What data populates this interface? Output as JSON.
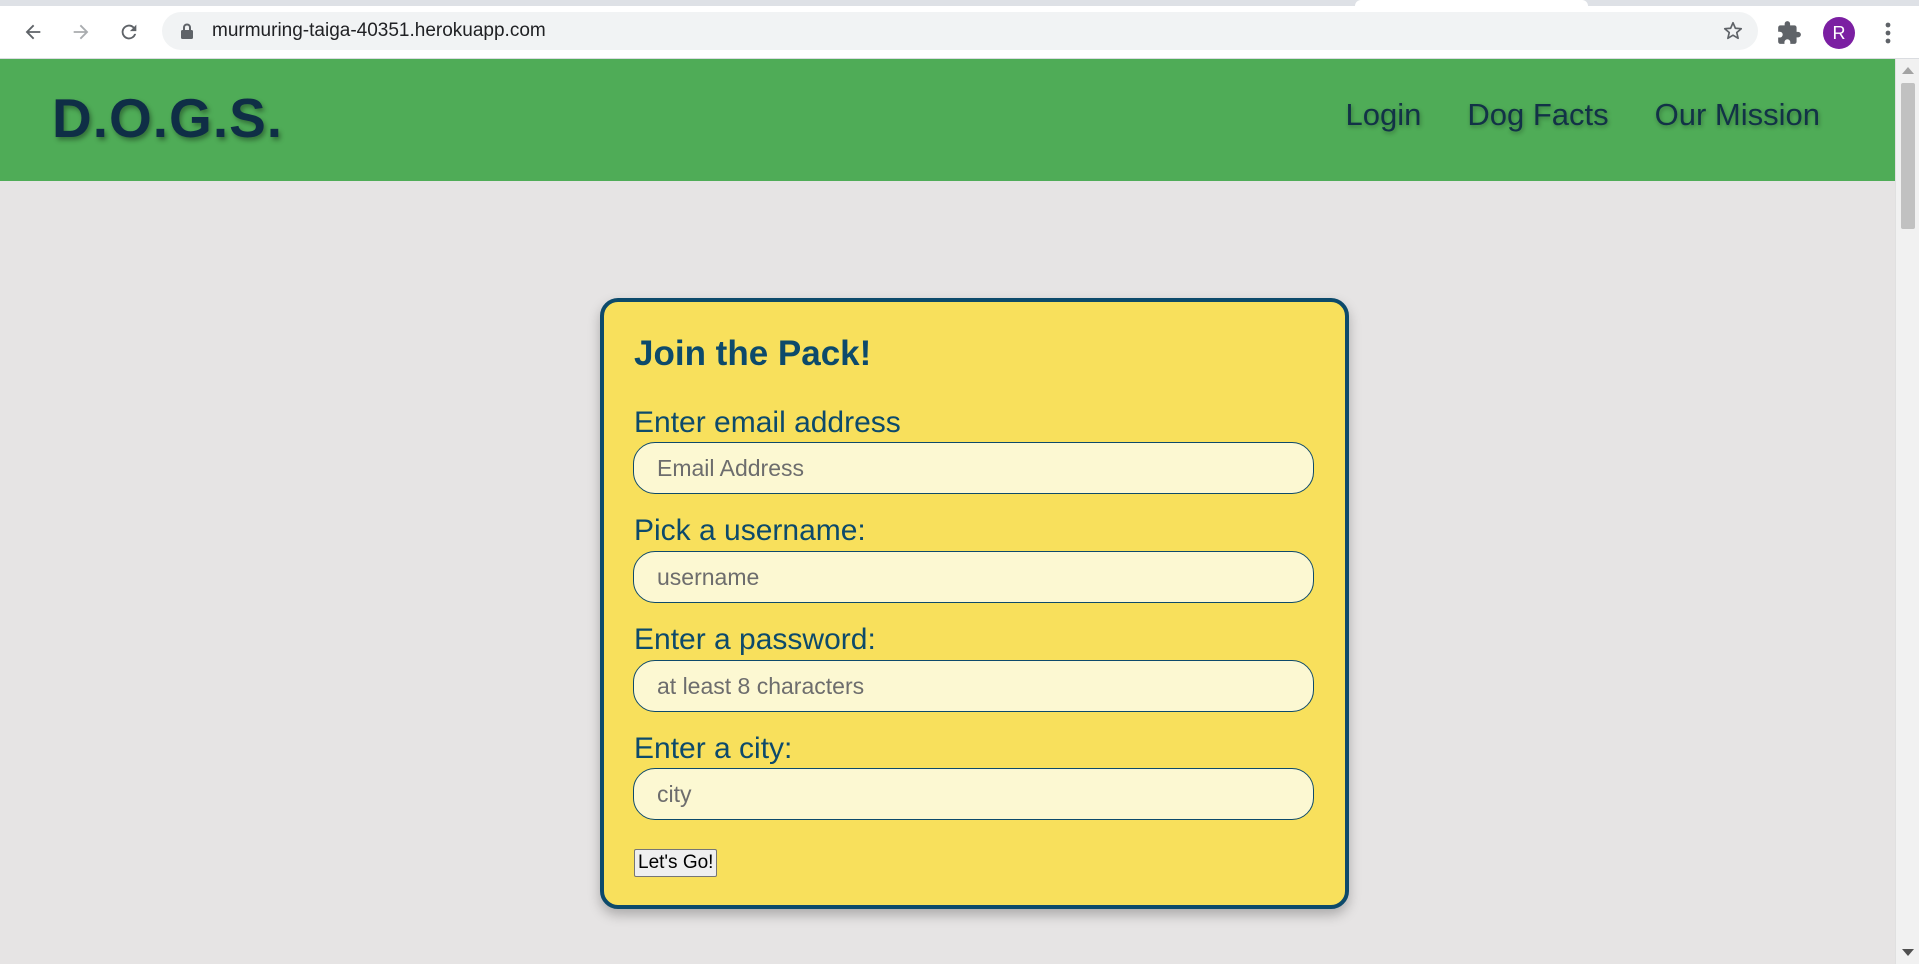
{
  "browser": {
    "url": "murmuring-taiga-40351.herokuapp.com",
    "profile_initial": "R",
    "icons": {
      "back": "arrow-left-icon",
      "forward": "arrow-right-icon",
      "reload": "reload-icon",
      "lock": "lock-icon",
      "bookmark": "star-icon",
      "extensions": "puzzle-icon",
      "menu": "kebab-menu-icon"
    }
  },
  "site": {
    "brand": "D.O.G.S.",
    "nav": [
      {
        "label": "Login"
      },
      {
        "label": "Dog Facts"
      },
      {
        "label": "Our Mission"
      }
    ]
  },
  "signup": {
    "title": "Join the Pack!",
    "fields": [
      {
        "label": "Enter email address",
        "placeholder": "Email Address",
        "value": ""
      },
      {
        "label": "Pick a username:",
        "placeholder": "username",
        "value": ""
      },
      {
        "label": "Enter a password:",
        "placeholder": "at least 8 characters",
        "value": ""
      },
      {
        "label": "Enter a city:",
        "placeholder": "city",
        "value": ""
      }
    ],
    "submit_label": "Let's Go!"
  },
  "colors": {
    "header_green": "#4fac57",
    "brand_navy": "#0f2e46",
    "card_yellow": "#f8e05c",
    "card_border": "#0d4a6b",
    "input_bg": "#fcf8d2",
    "page_bg": "#e6e4e4"
  }
}
